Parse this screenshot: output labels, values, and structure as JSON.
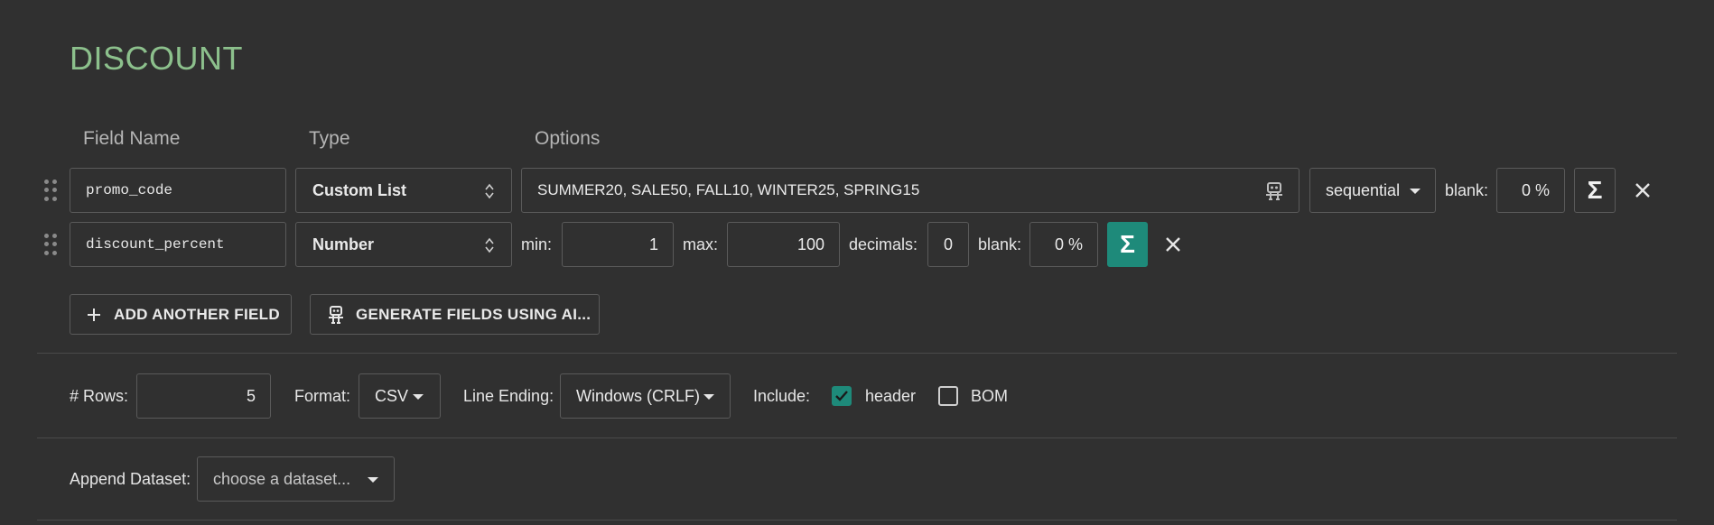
{
  "section_title": "DISCOUNT",
  "columns": {
    "field_name": "Field Name",
    "type": "Type",
    "options": "Options"
  },
  "fields": [
    {
      "name": "promo_code",
      "type": "Custom List",
      "list_values": "SUMMER20, SALE50, FALL10, WINTER25, SPRING15",
      "order": "sequential",
      "blank_label": "blank:",
      "blank_value": "0 %"
    },
    {
      "name": "discount_percent",
      "type": "Number",
      "min_label": "min:",
      "min_value": "1",
      "max_label": "max:",
      "max_value": "100",
      "decimals_label": "decimals:",
      "decimals_value": "0",
      "blank_label": "blank:",
      "blank_value": "0 %"
    }
  ],
  "actions": {
    "add_field": "ADD ANOTHER FIELD",
    "generate_ai": "GENERATE FIELDS USING AI..."
  },
  "settings": {
    "rows_label": "# Rows:",
    "rows_value": "5",
    "format_label": "Format:",
    "format_value": "CSV",
    "line_ending_label": "Line Ending:",
    "line_ending_value": "Windows (CRLF)",
    "include_label": "Include:",
    "header_label": "header",
    "header_checked": true,
    "bom_label": "BOM",
    "bom_checked": false
  },
  "append": {
    "label": "Append Dataset:",
    "placeholder": "choose a dataset..."
  },
  "colors": {
    "accent_teal": "#1e8a7a",
    "title_green": "#8cc08c",
    "background": "#303030"
  },
  "icons": [
    "drag-handle-icon",
    "up-down-arrows-icon",
    "robot-icon",
    "sigma-icon",
    "close-icon",
    "plus-icon",
    "caret-down-icon",
    "checkbox-icon"
  ]
}
